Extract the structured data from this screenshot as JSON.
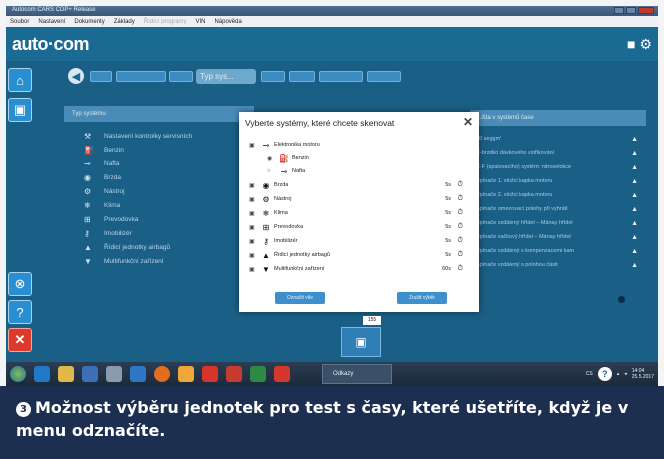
{
  "window": {
    "title": "Autocom CARS CDP+ Release",
    "menu": [
      "Soubor",
      "Nastavení",
      "Dokumenty",
      "Základy",
      "Řídící programy",
      "VIN",
      "Nápověda"
    ]
  },
  "app": {
    "logo": "auto·com"
  },
  "nav": {
    "search_placeholder": "Typ sys..."
  },
  "panels": {
    "left_header": "Typ systému",
    "left_items": [
      {
        "icon": "wrench-icon",
        "label": "Nastavení kontrolky servisních"
      },
      {
        "icon": "petrol-icon",
        "label": "Benzin"
      },
      {
        "icon": "diesel-icon",
        "label": "Nafta"
      },
      {
        "icon": "brake-icon",
        "label": "Brzda"
      },
      {
        "icon": "tool-icon",
        "label": "Nástroj"
      },
      {
        "icon": "climate-icon",
        "label": "Klima"
      },
      {
        "icon": "gearbox-icon",
        "label": "Prevodovka"
      },
      {
        "icon": "immobilizer-icon",
        "label": "Imobilizér"
      },
      {
        "icon": "airbag-icon",
        "label": "Řídicí jednotky airbagů"
      },
      {
        "icon": "multifunction-icon",
        "label": "Multifunkční zařízení"
      }
    ],
    "right_header": "Lišta v systémů čase",
    "right_items": [
      "10 seggm'",
      "C-brzdko dávkového vstřikování",
      "C-F (spalovacího) systém: nitroselokce",
      "Spínače 1. složci kapka motoru",
      "Spínače 2. složci kapka motoru",
      "Spínače omezovací polohy při vyhrátí",
      "Spínače vzdálený hřídel – Mánay hřídel",
      "Spínače vačkový hřídel – Mánay hřídel",
      "Spínače vzdálený s kompenzacemi kam",
      "Spínače vzdálený s polohou části"
    ]
  },
  "modal": {
    "title": "Vyberte systémy, které chcete skenovat",
    "rows": [
      {
        "icon": "engine-electronics-icon",
        "label": "Elektronika motoru",
        "time": "",
        "sub": false,
        "type": "check"
      },
      {
        "icon": "petrol-icon",
        "label": "Benzin",
        "time": "",
        "sub": true,
        "type": "radio"
      },
      {
        "icon": "diesel-icon",
        "label": "Nafta",
        "time": "",
        "sub": true,
        "type": "radio"
      },
      {
        "icon": "brake-icon",
        "label": "Brzda",
        "time": "5s",
        "sub": false,
        "type": "check"
      },
      {
        "icon": "tool-icon",
        "label": "Nástroj",
        "time": "5s",
        "sub": false,
        "type": "check"
      },
      {
        "icon": "climate-icon",
        "label": "Klima",
        "time": "5s",
        "sub": false,
        "type": "check"
      },
      {
        "icon": "gearbox-icon",
        "label": "Prevodovka",
        "time": "5s",
        "sub": false,
        "type": "check"
      },
      {
        "icon": "immobilizer-icon",
        "label": "Imobilizér",
        "time": "5s",
        "sub": false,
        "type": "check"
      },
      {
        "icon": "airbag-icon",
        "label": "Řídicí jednotky airbagů",
        "time": "5s",
        "sub": false,
        "type": "check"
      },
      {
        "icon": "multifunction-icon",
        "label": "Multifunkční zařízení",
        "time": "60s",
        "sub": false,
        "type": "check"
      }
    ],
    "btn_left": "Označit vše",
    "btn_right": "Zrušit výběr"
  },
  "footer": {
    "count": "155"
  },
  "taskbar": {
    "active_window": "Odkazy",
    "lang": "CS",
    "time": "14:04",
    "date": "25.5.2017"
  },
  "caption": {
    "number": "3",
    "text": "Možnost výběru jednotek pro test s časy, které ušetříte, když je v menu odznačíte."
  }
}
